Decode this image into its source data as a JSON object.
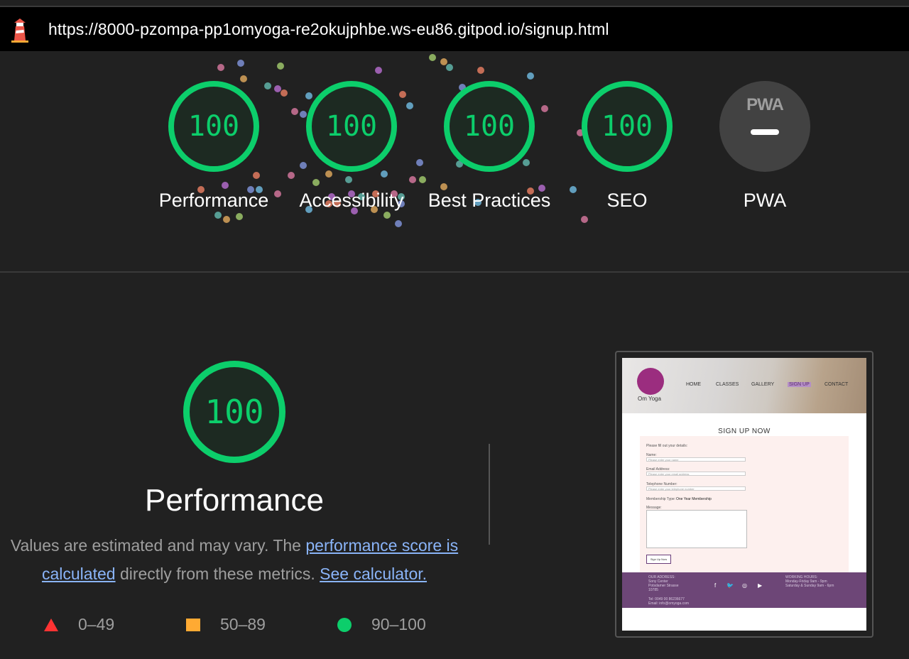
{
  "browser": {
    "url": "https://8000-pzompa-pp1omyoga-re2okujphbe.ws-eu86.gitpod.io/signup.html"
  },
  "colors": {
    "pass": "#0cce6b",
    "average": "#ffaa33",
    "fail": "#ff3333",
    "link": "#8ab4f8",
    "background": "#212121"
  },
  "categories": [
    {
      "label": "Performance",
      "score": "100"
    },
    {
      "label": "Accessibility",
      "score": "100"
    },
    {
      "label": "Best Practices",
      "score": "100"
    },
    {
      "label": "SEO",
      "score": "100"
    }
  ],
  "pwa": {
    "badge": "PWA",
    "label": "PWA"
  },
  "performance": {
    "score": "100",
    "title": "Performance",
    "desc_prefix": "Values are estimated and may vary. The ",
    "link1": "performance score is calculated",
    "desc_middle": " directly from these metrics. ",
    "link2": "See calculator."
  },
  "legend": [
    {
      "icon": "triangle-fail-icon",
      "range": "0–49"
    },
    {
      "icon": "square-average-icon",
      "range": "50–89"
    },
    {
      "icon": "circle-pass-icon",
      "range": "90–100"
    }
  ],
  "screenshot": {
    "logo_text": "Om Yoga",
    "nav": [
      "HOME",
      "CLASSES",
      "GALLERY",
      "SIGN UP",
      "CONTACT"
    ],
    "heading": "SIGN UP NOW",
    "intro": "Please fill out your details:",
    "name_label": "Name:",
    "name_placeholder": "Please enter your name",
    "email_label": "Email Address:",
    "email_placeholder": "Please enter your email address",
    "phone_label": "Telephone Number:",
    "phone_placeholder": "Please enter your telephone number",
    "membership_label": "Membership Type:",
    "membership_value": "One Year Membership",
    "message_label": "Message:",
    "button": "Sign Up Now",
    "address": "OUR ADDRESS:\nSony Center\nPotsdamer Strasse\n10785",
    "contact": "Tel: 0049 00 86236677\nEmail: info@omyoga.com",
    "hours": "WORKING HOURS:\nMonday-Friday 9am - 9pm\nSaturday & Sunday 9am - 6pm"
  }
}
